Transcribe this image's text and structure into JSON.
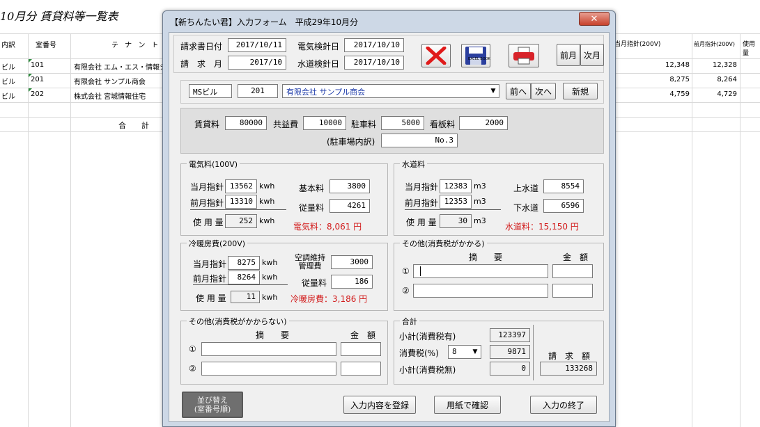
{
  "sheet": {
    "title": "10月分  賃貸料等一覧表",
    "headers": [
      "内訳",
      "室番号",
      "テ ナ ン ト 名",
      "当月指針(200V)",
      "前月指針(200V)",
      "使用量"
    ],
    "rows": [
      {
        "bldg": "ビル",
        "room": "101",
        "tenant": "有限会社 エム・エス・情報シ",
        "cur": "12,348",
        "prev": "12,328"
      },
      {
        "bldg": "ビル",
        "room": "201",
        "tenant": "有限会社 サンプル商会",
        "cur": "8,275",
        "prev": "8,264"
      },
      {
        "bldg": "ビル",
        "room": "202",
        "tenant": "株式会社 宮城情報住宅",
        "cur": "4,759",
        "prev": "4,729"
      }
    ],
    "total_label": "合　　計"
  },
  "dialog": {
    "title": "【新ちんたい君】入力フォーム　平成29年10月分",
    "close_glyph": "✕",
    "dates": {
      "invoice_date_label": "請求書日付",
      "invoice_date": "2017/10/11",
      "billing_month_label": "請　求　月",
      "billing_month": "2017/10",
      "elec_meter_label": "電気検針日",
      "elec_meter": "2017/10/10",
      "water_meter_label": "水道検針日",
      "water_meter": "2017/10/10"
    },
    "icons": {
      "delete": "red-x-icon",
      "save": "excel-floppy-icon",
      "print": "printer-icon",
      "excel_text": "EXCEL BOOK"
    },
    "prev_month_label": "前月",
    "next_month_label": "次月",
    "tenant": {
      "building": "MSビル",
      "room": "201",
      "name": "有限会社 サンプル商会",
      "prev_label": "前へ",
      "next_label": "次へ",
      "new_label": "新規"
    },
    "rent": {
      "rent_label": "賃貸料",
      "rent": "80000",
      "common_label": "共益費",
      "common": "10000",
      "parking_label": "駐車料",
      "parking": "5000",
      "sign_label": "看板料",
      "sign": "2000",
      "parking_detail_label": "(駐車場内訳)",
      "parking_detail": "No.3"
    },
    "electric": {
      "title": "電気料(100V)",
      "current_label": "当月指針",
      "current": "13562",
      "previous_label": "前月指針",
      "previous": "13310",
      "usage_label": "使 用 量",
      "usage": "252",
      "unit": "kwh",
      "basic_label": "基本料",
      "basic": "3800",
      "metered_label": "従量料",
      "metered": "4261",
      "total": "電気料：8,061 円"
    },
    "water": {
      "title": "水道料",
      "current_label": "当月指針",
      "current": "12383",
      "previous_label": "前月指針",
      "previous": "12353",
      "usage_label": "使 用 量",
      "usage": "30",
      "unit": "m3",
      "supply_label": "上水道",
      "supply": "8554",
      "sewer_label": "下水道",
      "sewer": "6596",
      "total": "水道料：15,150 円"
    },
    "hvac": {
      "title": "冷暖房費(200V)",
      "current_label": "当月指針",
      "current": "8275",
      "previous_label": "前月指針",
      "previous": "8264",
      "usage_label": "使 用 量",
      "usage": "11",
      "unit": "kwh",
      "maint_label_1": "空調維持",
      "maint_label_2": "管理費",
      "maint": "3000",
      "metered_label": "従量料",
      "metered": "186",
      "total": "冷暖房費：3,186 円"
    },
    "other_taxed": {
      "title": "その他(消費税がかかる)",
      "desc_header": "摘　　要",
      "amount_header": "金　額",
      "row1_mark": "①",
      "row2_mark": "②",
      "row1_desc": "",
      "row1_amount": "",
      "row2_desc": "",
      "row2_amount": ""
    },
    "other_untaxed": {
      "title": "その他(消費税がかからない)",
      "desc_header": "摘　　要",
      "amount_header": "金　額",
      "row1_mark": "①",
      "row2_mark": "②",
      "row1_desc": "",
      "row1_amount": "",
      "row2_desc": "",
      "row2_amount": ""
    },
    "totals": {
      "title": "合計",
      "subtotal_taxed_label": "小計(消費税有)",
      "subtotal_taxed": "123397",
      "tax_rate_label": "消費税(%)",
      "tax_rate": "8",
      "tax": "9871",
      "subtotal_untaxed_label": "小計(消費税無)",
      "subtotal_untaxed": "0",
      "billing_label": "請　求　額",
      "billing": "133268"
    },
    "buttons": {
      "sort_line1": "並び替え",
      "sort_line2": "(室番号順)",
      "register": "入力内容を登録",
      "preview": "用紙で確認",
      "finish": "入力の終了"
    }
  }
}
